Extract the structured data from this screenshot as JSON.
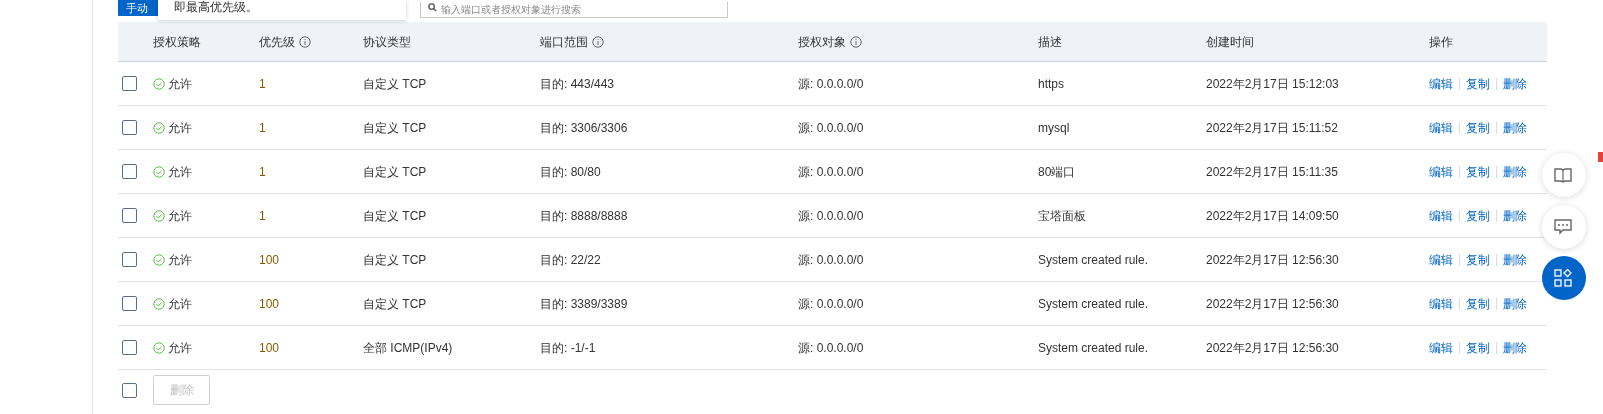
{
  "toolbar": {
    "add_button": "手动",
    "tooltip": "即最高优先级。",
    "search": {
      "placeholder": "输入端口或者授权对象进行搜索"
    }
  },
  "table": {
    "columns": [
      {
        "label": "授权策略",
        "info": false
      },
      {
        "label": "优先级",
        "info": true
      },
      {
        "label": "协议类型",
        "info": false
      },
      {
        "label": "端口范围",
        "info": true
      },
      {
        "label": "授权对象",
        "info": true
      },
      {
        "label": "描述",
        "info": false
      },
      {
        "label": "创建时间",
        "info": false
      },
      {
        "label": "操作",
        "info": false
      }
    ],
    "rows": [
      {
        "checked": false,
        "policy": "允许",
        "priority": "1",
        "protocol": "自定义 TCP",
        "port": "目的: 443/443",
        "source": "源: 0.0.0.0/0",
        "description": "https",
        "created": "2022年2月17日 15:12:03",
        "actions": [
          "编辑",
          "复制",
          "删除"
        ]
      },
      {
        "checked": false,
        "policy": "允许",
        "priority": "1",
        "protocol": "自定义 TCP",
        "port": "目的: 3306/3306",
        "source": "源: 0.0.0.0/0",
        "description": "mysql",
        "created": "2022年2月17日 15:11:52",
        "actions": [
          "编辑",
          "复制",
          "删除"
        ]
      },
      {
        "checked": false,
        "policy": "允许",
        "priority": "1",
        "protocol": "自定义 TCP",
        "port": "目的: 80/80",
        "source": "源: 0.0.0.0/0",
        "description": "80端口",
        "created": "2022年2月17日 15:11:35",
        "actions": [
          "编辑",
          "复制",
          "删除"
        ]
      },
      {
        "checked": false,
        "policy": "允许",
        "priority": "1",
        "protocol": "自定义 TCP",
        "port": "目的: 8888/8888",
        "source": "源: 0.0.0.0/0",
        "description": "宝塔面板",
        "created": "2022年2月17日 14:09:50",
        "actions": [
          "编辑",
          "复制",
          "删除"
        ]
      },
      {
        "checked": false,
        "policy": "允许",
        "priority": "100",
        "protocol": "自定义 TCP",
        "port": "目的: 22/22",
        "source": "源: 0.0.0.0/0",
        "description": "System created rule.",
        "created": "2022年2月17日 12:56:30",
        "actions": [
          "编辑",
          "复制",
          "删除"
        ]
      },
      {
        "checked": false,
        "policy": "允许",
        "priority": "100",
        "protocol": "自定义 TCP",
        "port": "目的: 3389/3389",
        "source": "源: 0.0.0.0/0",
        "description": "System created rule.",
        "created": "2022年2月17日 12:56:30",
        "actions": [
          "编辑",
          "复制",
          "删除"
        ]
      },
      {
        "checked": false,
        "policy": "允许",
        "priority": "100",
        "protocol": "全部 ICMP(IPv4)",
        "port": "目的: -1/-1",
        "source": "源: 0.0.0.0/0",
        "description": "System created rule.",
        "created": "2022年2月17日 12:56:30",
        "actions": [
          "编辑",
          "复制",
          "删除"
        ]
      }
    ]
  },
  "footer": {
    "select_all_checked": false,
    "delete_button": {
      "label": "删除",
      "disabled": true
    }
  }
}
